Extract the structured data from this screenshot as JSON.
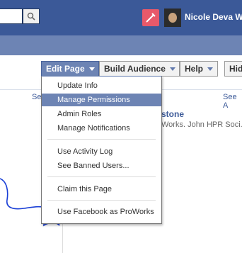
{
  "topbar": {
    "username": "Nicole Deva We"
  },
  "tabs": {
    "edit_page": "Edit Page",
    "build_audience": "Build Audience",
    "help": "Help",
    "hide": "Hid"
  },
  "background": {
    "see_left": "Se",
    "see_right": "See A",
    "name": "stone",
    "sub": "Works. John HPR Soci."
  },
  "menu": {
    "group1": [
      "Update Info",
      "Manage Permissions",
      "Admin Roles",
      "Manage Notifications"
    ],
    "group2": [
      "Use Activity Log",
      "See Banned Users..."
    ],
    "group3": [
      "Claim this Page"
    ],
    "group4": [
      "Use Facebook as ProWorks"
    ],
    "highlighted": "Manage Permissions"
  },
  "colors": {
    "brand": "#3b5998",
    "subbar": "#6d84b4",
    "annotation": "#1a3fd6"
  }
}
